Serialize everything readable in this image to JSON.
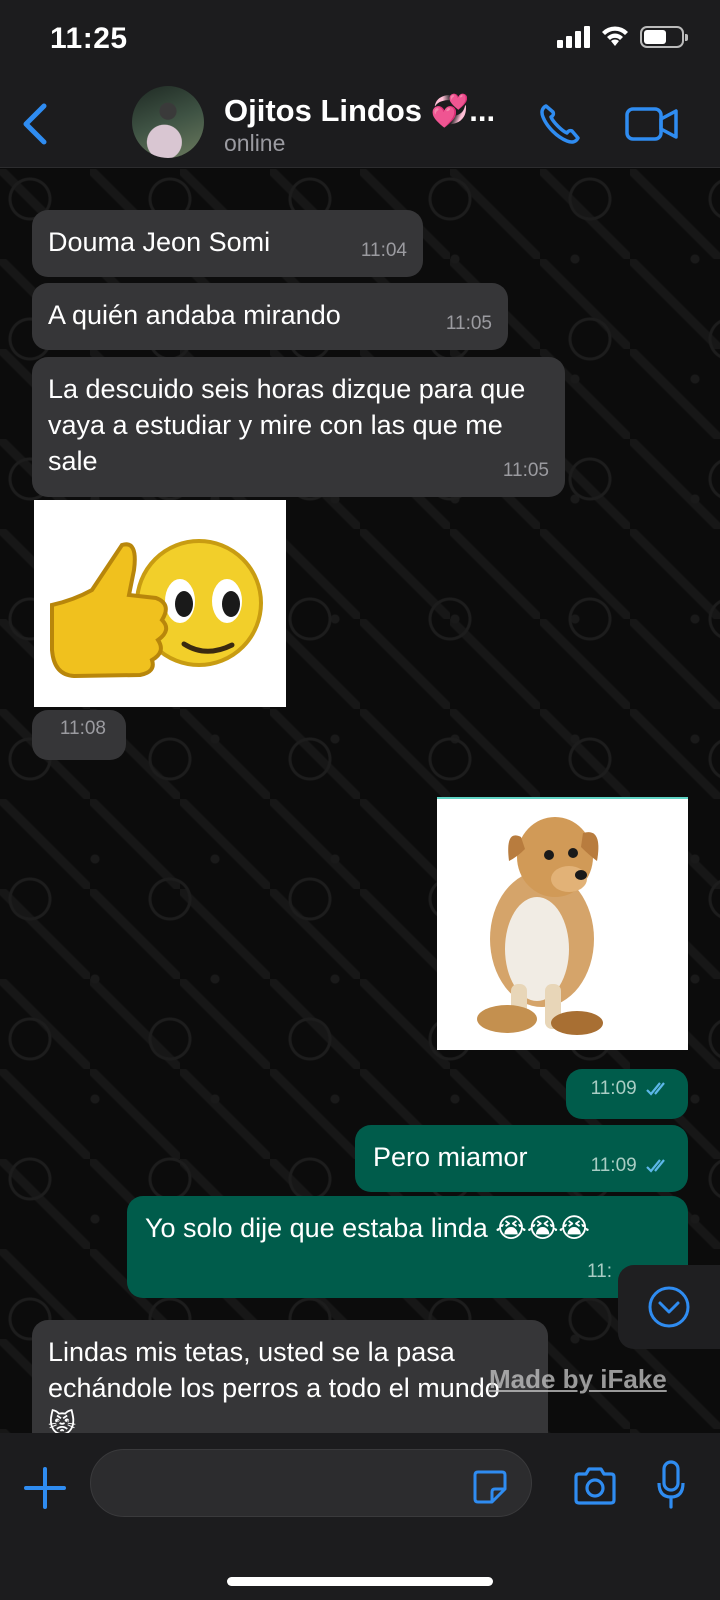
{
  "status_bar": {
    "time": "11:25"
  },
  "header": {
    "contact_name": "Ojitos Lindos 💞...",
    "status": "online"
  },
  "messages": [
    {
      "text": "Douma Jeon Somi",
      "time": "11:04"
    },
    {
      "text": "A quién andaba mirando",
      "time": "11:05"
    },
    {
      "text": "La descuido seis horas dizque para que vaya a estudiar y mire con las que me sale",
      "time": "11:05"
    },
    {
      "time": "11:08"
    },
    {
      "time": "11:09"
    },
    {
      "text": "Pero miamor",
      "time": "11:09"
    },
    {
      "text": "Yo solo dije que estaba linda 😭😭😭",
      "time": "11:"
    },
    {
      "text": "Lindas mis tetas, usted se la pasa echándole los perros a todo el mundo 😾"
    }
  ],
  "watermark": "Made by iFake",
  "colors": {
    "accent": "#2f8cf1",
    "incoming_bubble": "#363638",
    "outgoing_bubble": "#005c4b",
    "read_ticks": "#5cb7e8"
  },
  "icons": [
    "back-icon",
    "phone-icon",
    "video-icon",
    "plus-icon",
    "sticker-icon",
    "camera-icon",
    "mic-icon",
    "chevron-down-icon",
    "double-check-icon"
  ]
}
